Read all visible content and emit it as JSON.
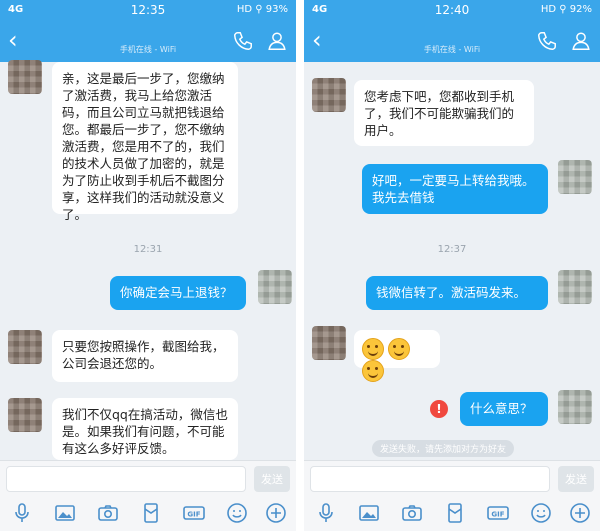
{
  "left": {
    "status": {
      "network": "4G",
      "time": "12:35",
      "battery": "HD ⚲ 93%"
    },
    "nav": {
      "subtitle": "手机在线 - WiFi"
    },
    "messages": {
      "m1": "亲，这是最后一步了，您缴纳了激活费，我马上给您激活码，而且公司立马就把钱退给您。都最后一步了，您不缴纳激活费，您是用不了的，我们的技术人员做了加密的，就是为了防止收到手机后不截图分享，这样我们的活动就没意义了。",
      "time1": "12:31",
      "m2": "你确定会马上退钱？",
      "m3": "只要您按照操作，截图给我，公司会退还您的。",
      "m4": "我们不仅qq在搞活动，微信也是。如果我们有问题，不可能有这么多好评反馈。"
    },
    "input": {
      "send_label": "发送"
    }
  },
  "right": {
    "status": {
      "network": "4G",
      "time": "12:40",
      "battery": "HD ⚲ 92%"
    },
    "nav": {
      "subtitle": "手机在线 - WiFi"
    },
    "messages": {
      "m1": "您考虑下吧，您都收到手机了，我们不可能欺骗我们的用户。",
      "m2": "好吧，一定要马上转给我哦。我先去借钱",
      "time1": "12:37",
      "m3": "钱微信转了。激活码发来。",
      "m5": "什么意思？",
      "tip": "发送失败，请先添加对方为好友"
    },
    "input": {
      "send_label": "发送"
    }
  },
  "colors": {
    "accent": "#3aa6ea",
    "bubble_out": "#1aa3f0",
    "bubble_in": "#ffffff",
    "background": "#ecf0f4",
    "error": "#f0483e"
  },
  "icons": [
    "back-chevron-icon",
    "phone-icon",
    "contact-icon",
    "mic-icon",
    "image-icon",
    "camera-icon",
    "red-packet-icon",
    "gif-icon",
    "emoji-icon",
    "plus-icon",
    "error-icon"
  ]
}
